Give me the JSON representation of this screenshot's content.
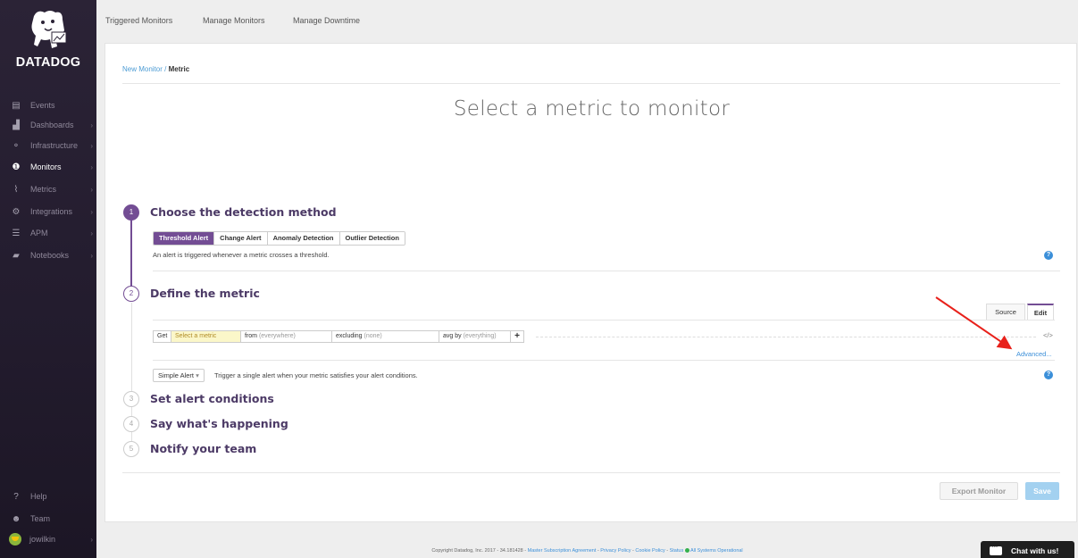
{
  "app": {
    "name": "DATADOG"
  },
  "sidebar": {
    "items": [
      {
        "label": "Events",
        "icon": "events-icon",
        "glyph": "▤"
      },
      {
        "label": "Dashboards",
        "icon": "dashboards-icon",
        "glyph": "▟"
      },
      {
        "label": "Infrastructure",
        "icon": "infrastructure-icon",
        "glyph": "⚬"
      },
      {
        "label": "Monitors",
        "icon": "monitors-icon",
        "glyph": "❶",
        "active": true
      },
      {
        "label": "Metrics",
        "icon": "metrics-icon",
        "glyph": "⌇"
      },
      {
        "label": "Integrations",
        "icon": "integrations-icon",
        "glyph": "⚙"
      },
      {
        "label": "APM",
        "icon": "apm-icon",
        "glyph": "☰"
      },
      {
        "label": "Notebooks",
        "icon": "notebooks-icon",
        "glyph": "▰"
      }
    ],
    "bottom": [
      {
        "label": "Help",
        "icon": "help-icon",
        "glyph": "?"
      },
      {
        "label": "Team",
        "icon": "team-icon",
        "glyph": "☻"
      },
      {
        "label": "jowilkin",
        "icon": "user-avatar"
      }
    ]
  },
  "topnav": {
    "tabs": [
      "Triggered Monitors",
      "Manage Monitors",
      "Manage Downtime"
    ]
  },
  "breadcrumb": {
    "parent": "New Monitor",
    "separator": " / ",
    "current": "Metric"
  },
  "page_title": "Select a metric to monitor",
  "steps": [
    {
      "number": "1",
      "title": "Choose the detection method"
    },
    {
      "number": "2",
      "title": "Define the metric"
    },
    {
      "number": "3",
      "title": "Set alert conditions"
    },
    {
      "number": "4",
      "title": "Say what's happening"
    },
    {
      "number": "5",
      "title": "Notify your team"
    }
  ],
  "detection": {
    "options": [
      "Threshold Alert",
      "Change Alert",
      "Anomaly Detection",
      "Outlier Detection"
    ],
    "selected": "Threshold Alert",
    "description": "An alert is triggered whenever a metric crosses a threshold."
  },
  "editor_tabs": {
    "source": "Source",
    "edit": "Edit"
  },
  "query": {
    "get_label": "Get",
    "metric_placeholder": "Select a metric",
    "from_label": "from",
    "from_placeholder": "(everywhere)",
    "excluding_label": "excluding",
    "excluding_placeholder": "(none)",
    "avg_by_label": "avg by",
    "avg_by_placeholder": "(everything)",
    "plus": "+",
    "code_toggle": "</>",
    "advanced": "Advanced..."
  },
  "alert_type": {
    "selected": "Simple Alert",
    "description": "Trigger a single alert when your metric satisfies your alert conditions."
  },
  "buttons": {
    "export": "Export Monitor",
    "save": "Save"
  },
  "footer": {
    "copyright": "Copyright Datadog, Inc. 2017 - 34.181428 - ",
    "link1": "Master Subscription Agreement",
    "link2": "Privacy Policy",
    "link3": "Cookie Policy",
    "link4": "Status",
    "status": "All Systems Operational",
    "sep": " - "
  },
  "chat": {
    "label": "Chat with us!"
  },
  "colors": {
    "accent": "#734d94",
    "link": "#3b8fd9",
    "annotation_arrow": "#e8211b"
  }
}
